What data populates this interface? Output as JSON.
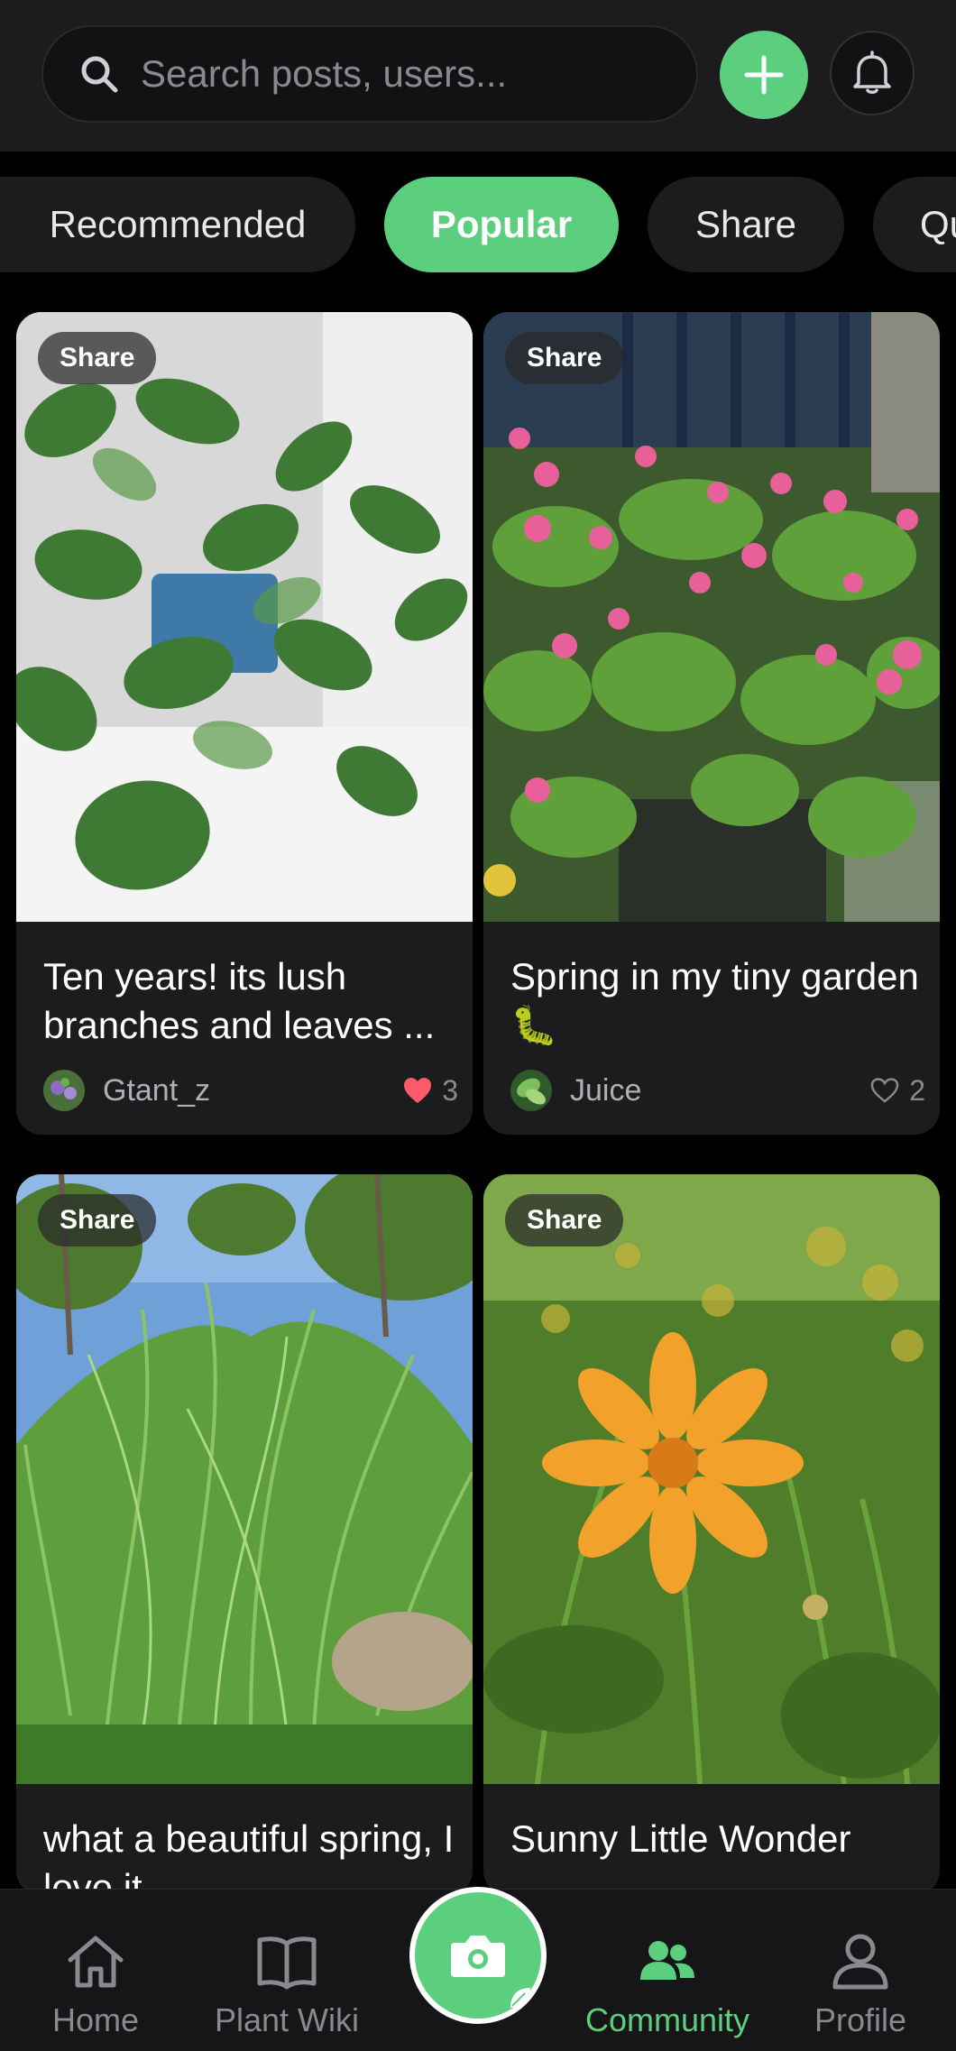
{
  "search": {
    "placeholder": "Search posts, users..."
  },
  "header": {
    "add_icon": "plus-icon",
    "bell_icon": "bell-icon"
  },
  "tabs": [
    {
      "label": "Recommended",
      "active": false
    },
    {
      "label": "Popular",
      "active": true
    },
    {
      "label": "Share",
      "active": false
    },
    {
      "label": "Qu",
      "active": false
    }
  ],
  "posts": [
    {
      "badge": "Share",
      "title": "Ten years!   its lush branches and leaves ...",
      "author": "Gtant_z",
      "likes": "3",
      "liked": true
    },
    {
      "badge": "Share",
      "title": "Spring in my tiny garden🐛",
      "author": "Juice",
      "likes": "2",
      "liked": false
    },
    {
      "badge": "Share",
      "title": "what a beautiful spring, I love it",
      "author": "",
      "likes": "",
      "liked": false
    },
    {
      "badge": "Share",
      "title": "Sunny Little Wonder",
      "author": "",
      "likes": "",
      "liked": false
    }
  ],
  "nav": {
    "home": "Home",
    "wiki": "Plant Wiki",
    "community": "Community",
    "profile": "Profile",
    "active": "community"
  },
  "colors": {
    "accent": "#5ccf7e",
    "like": "#ff5a6a",
    "background": "#000000",
    "card": "#1c1c1e"
  }
}
